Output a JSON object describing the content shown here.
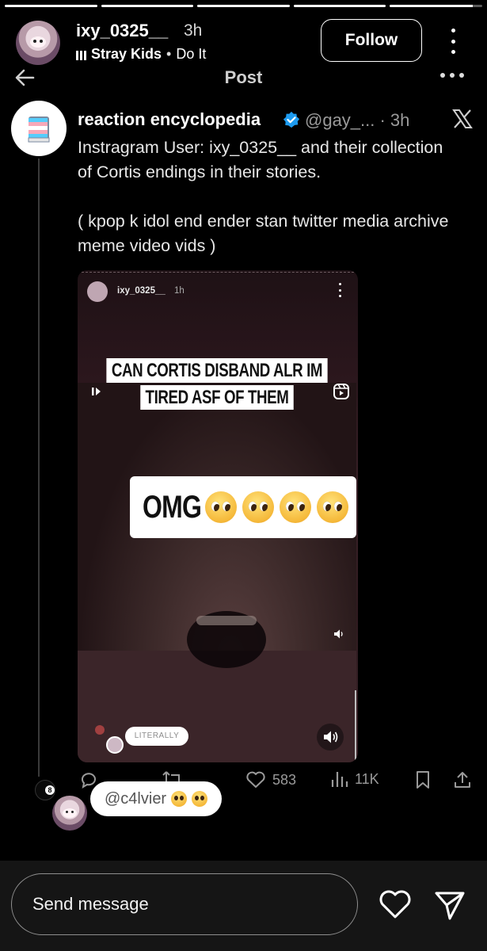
{
  "story": {
    "progress": [
      1,
      1,
      1,
      1,
      0.9
    ],
    "username": "ixy_0325__",
    "time": "3h",
    "music_artist": "Stray Kids",
    "music_separator": "•",
    "music_track": "Do It",
    "follow_label": "Follow"
  },
  "post_header": {
    "title": "Post"
  },
  "tweet": {
    "name": "reaction encyclopedia",
    "handle_time": "@gay_... · 3h",
    "text_1": "Instragram User: ixy_0325__ and their collection of Cortis endings in their stories.",
    "text_2": "( kpop k idol end ender stan twitter media archive meme video vids )"
  },
  "media": {
    "username": "ixy_0325__",
    "time": "1h",
    "caption_top": "CAN CORTIS DISBAND ALR IM TIRED ASF OF THEM",
    "caption_main": "OMG",
    "sticker": "LITERALLY"
  },
  "actions": {
    "likes": "583",
    "views": "11K"
  },
  "comment": {
    "badge": "8",
    "text": "@c4lvier"
  },
  "message_bar": {
    "placeholder": "Send message"
  }
}
